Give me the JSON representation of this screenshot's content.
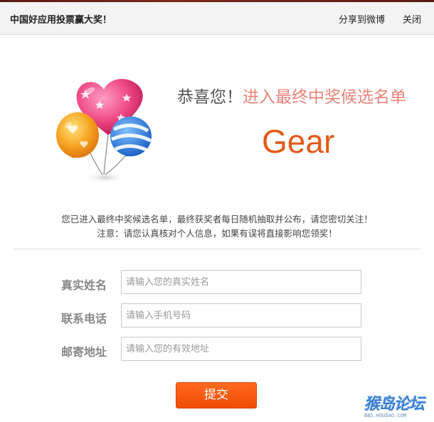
{
  "header": {
    "title": "中国好应用投票赢大奖！",
    "share_label": "分享到微博",
    "close_label": "关闭"
  },
  "congrats": {
    "prefix": "恭喜您！",
    "highlight": "进入最终中奖候选名单"
  },
  "app_name": "Gear",
  "notice": {
    "line1": "您已进入最终中奖候选名单，最终获奖者每日随机抽取并公布，请您密切关注！",
    "line2": "注意：请您认真核对个人信息，如果有误将直接影响您领奖！"
  },
  "form": {
    "fields": [
      {
        "label": "真实姓名",
        "placeholder": "请输入您的真实姓名",
        "value": ""
      },
      {
        "label": "联系电话",
        "placeholder": "请输入手机号码",
        "value": ""
      },
      {
        "label": "邮寄地址",
        "placeholder": "请输入您的有效地址",
        "value": ""
      }
    ],
    "submit_label": "提交"
  },
  "watermark": {
    "text": "猴岛论坛",
    "sub": "BBS.HOUDAO.COM"
  },
  "colors": {
    "accent": "#f04c05",
    "app_name": "#e35a1a",
    "highlight": "#e8837a"
  }
}
